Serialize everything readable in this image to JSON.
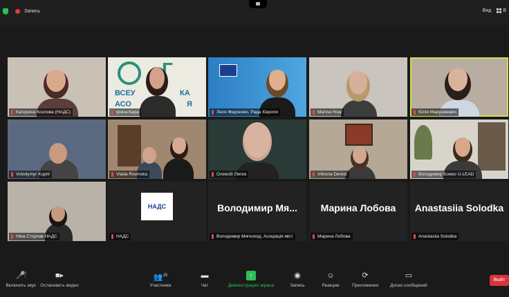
{
  "topbar": {
    "recording_label": "Запись",
    "view_label": "Вид",
    "view_extra": "В"
  },
  "participants": [
    {
      "name": "Катерина Козлова (НАДС)"
    },
    {
      "name": "Ірина Кара"
    },
    {
      "name": "Леся Федченко, Рада Європи"
    },
    {
      "name": "Marina Hray"
    },
    {
      "name": "Юлія Марушкевич"
    },
    {
      "name": "Volodymyr Kuprii"
    },
    {
      "name": "Vlada Rovinska"
    },
    {
      "name": "Олексій Ляпок"
    },
    {
      "name": "Viktoria Derets"
    },
    {
      "name": "Володимир Божко U-LEAD"
    },
    {
      "name": "Ніна Сторчак НАДС"
    },
    {
      "name": "НАДС",
      "logo_text": "НАДС"
    },
    {
      "name": "Володимир Мягкоход, Асоціація міст",
      "display": "Володимир Мя..."
    },
    {
      "name": "Марина Лобова",
      "display": "Марина Лобова"
    },
    {
      "name": "Anastasiia Solodka",
      "display": "Anastasiia Solodka"
    }
  ],
  "tile_texts": {
    "banner_1": "ВСЕУ",
    "banner_2": "КА",
    "banner_3": "АСО",
    "banner_4": "Я"
  },
  "toolbar": {
    "mute": "Включить звук",
    "video": "Остановить видео",
    "participants": "Участники",
    "participants_count": "15",
    "chat": "Чат",
    "share": "Демонстрация экрана",
    "record": "Запись",
    "reactions": "Реакции",
    "apps": "Приложения",
    "whiteboard": "Доски сообщений",
    "leave": "Выйт"
  },
  "colors": {
    "active_border": "#cde04a",
    "share_green": "#2fbf5a",
    "leave_red": "#d9343a"
  }
}
